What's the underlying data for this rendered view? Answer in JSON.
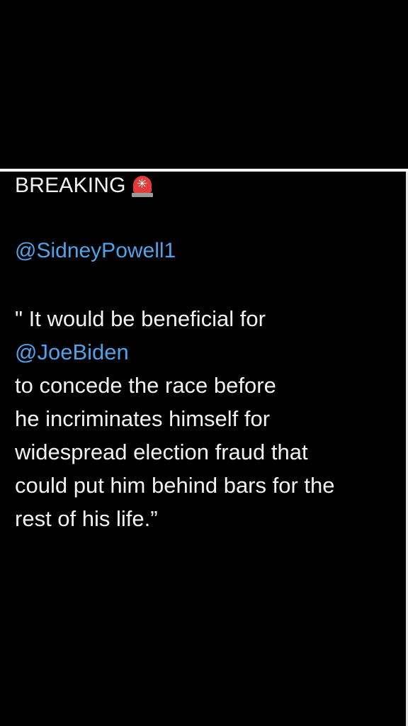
{
  "post": {
    "header": "BREAKING",
    "alert_icon": "police-siren-icon",
    "handle": "@SidneyPowell1",
    "quote_lines": [
      "\" It would be beneficial for",
      "@JoeBiden",
      "to concede the race before",
      "he incriminates himself for",
      "widespread election fraud that",
      "could put him behind bars for the",
      "rest of his life.”"
    ]
  },
  "colors": {
    "background": "#000000",
    "text": "#f2f2f2",
    "mention": "#4fa3ea",
    "siren": "#e23b3b",
    "divider": "#ffffff"
  }
}
